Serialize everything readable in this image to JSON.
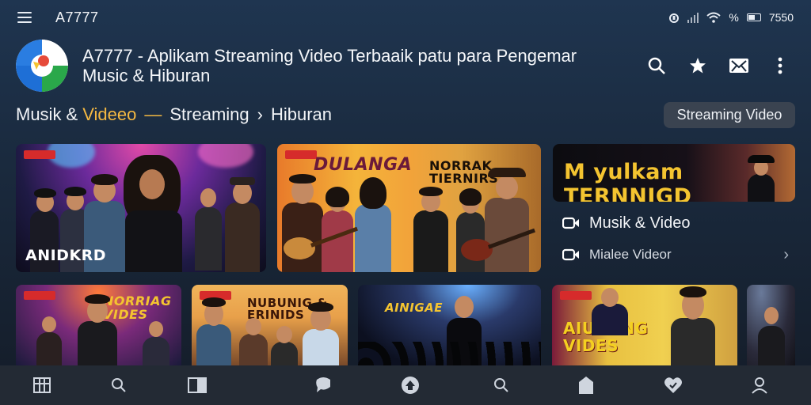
{
  "status_bar": {
    "title": "A7777",
    "battery_text": "%",
    "time": "7550"
  },
  "header": {
    "app_title": "A7777 - Aplikam Streaming Video Terbaaik patu para Pengemar Music & Hiburan",
    "actions": [
      "search-icon",
      "star-icon",
      "message-icon",
      "more-icon"
    ]
  },
  "breadcrumb": {
    "part1": "Musik &",
    "part2": "Videeo",
    "dash": "—",
    "part3": "Streaming",
    "arrow": "›",
    "part4": "Hiburan"
  },
  "chip": {
    "label": "Streaming Video"
  },
  "cards_top": [
    {
      "title": "ANIDKRD"
    },
    {
      "title": "DULANGA"
    },
    {
      "title": "NORRAK TIERNIRS"
    }
  ],
  "feature": {
    "banner_title": "M yulkam TERNNIGD",
    "items": [
      {
        "label": "Musik & Video"
      },
      {
        "label": "Mialee Videor"
      }
    ]
  },
  "cards_bottom": [
    {
      "title": "NORRIAG VIDES"
    },
    {
      "title": "NUBUNIG & ERINIDS"
    },
    {
      "title": "AINIGAE"
    },
    {
      "title": "AIURUNG VIDES"
    }
  ],
  "bottom_nav": [
    "grid-icon",
    "search-icon",
    "video-icon",
    "chat-icon",
    "home-icon",
    "search-icon",
    "library-icon",
    "favorites-icon",
    "profile-icon"
  ],
  "colors": {
    "accent": "#f5b942",
    "background": "#1a2a3e",
    "nav_background": "#232a34"
  }
}
